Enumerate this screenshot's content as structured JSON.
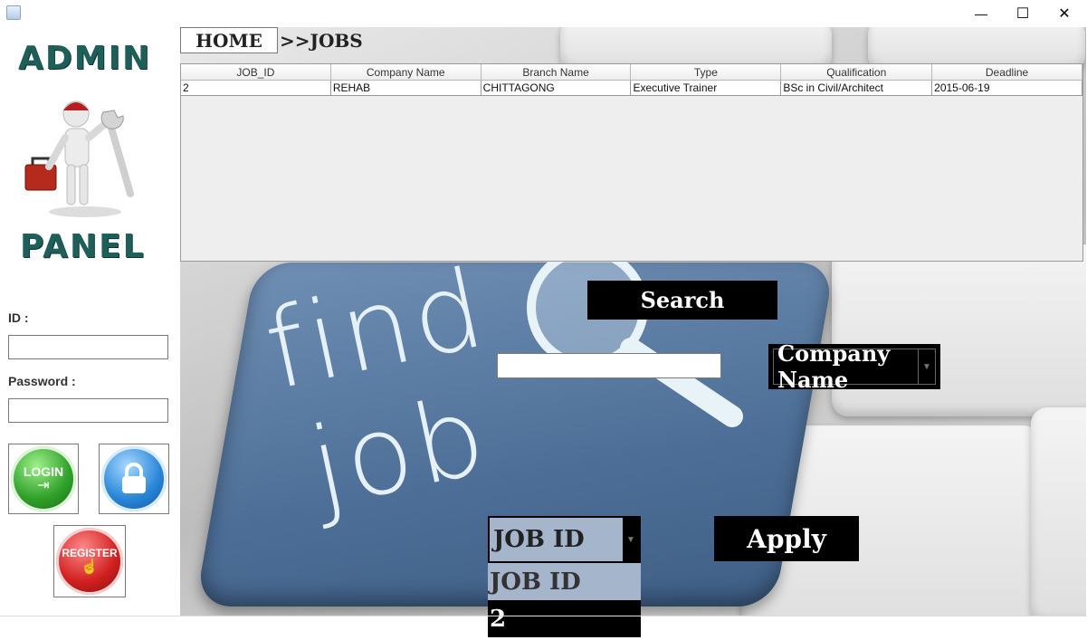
{
  "window": {
    "minimize_glyph": "—",
    "maximize_glyph": "☐",
    "close_glyph": "✕"
  },
  "sidebar": {
    "logo_top": "ADMIN",
    "logo_bottom": "PANEL",
    "id_label": "ID :",
    "id_value": "",
    "password_label": "Password :",
    "password_value": "",
    "login_label": "LOGIN",
    "register_label": "REGISTER"
  },
  "breadcrumb": {
    "home": "HOME",
    "current": ">>JOBS"
  },
  "table": {
    "columns": [
      "JOB_ID",
      "Company Name",
      "Branch Name",
      "Type",
      "Qualification",
      "Deadline"
    ],
    "rows": [
      [
        "2",
        "REHAB",
        "CHITTAGONG",
        "Executive Trainer",
        "BSc in Civil/Architect",
        "2015-06-19"
      ]
    ]
  },
  "search": {
    "button_label": "Search",
    "input_value": "",
    "filter_selected": "Company Name"
  },
  "apply": {
    "button_label": "Apply",
    "job_combo_selected": "JOB ID",
    "dropdown_options": [
      "JOB ID",
      "2"
    ]
  },
  "background": {
    "key_text_top": "find",
    "key_text_bottom": "job"
  },
  "colors": {
    "button_bg": "#000000",
    "combo_bg": "#a4b5cc",
    "table_bg": "#eeeeee",
    "logo_teal": "#1f5f5a"
  }
}
